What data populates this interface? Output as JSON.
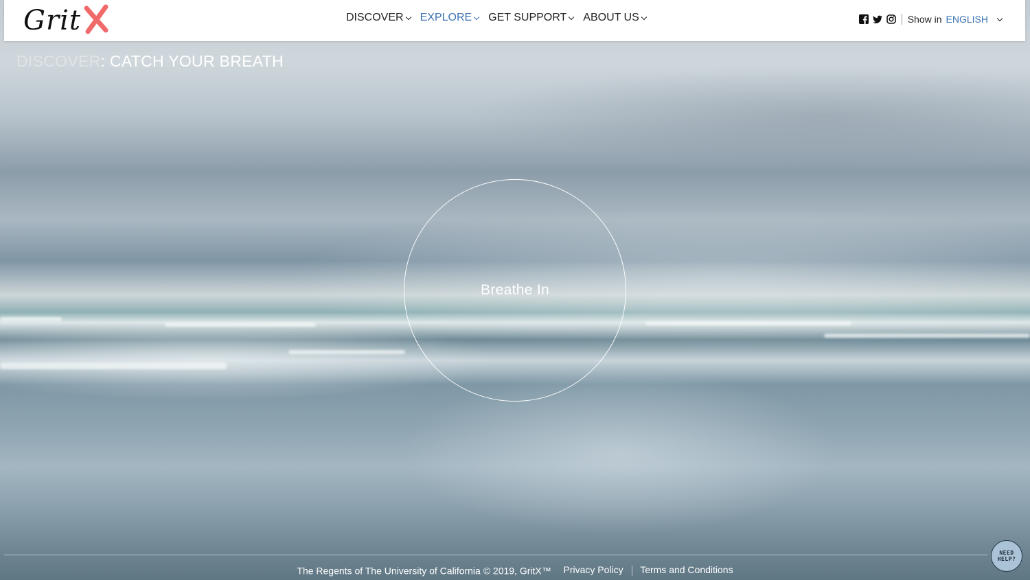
{
  "logo": {
    "text": "Grit",
    "accent": "X",
    "accent_color": "#f06a6a"
  },
  "nav": {
    "items": [
      {
        "label": "DISCOVER",
        "active": false
      },
      {
        "label": "EXPLORE",
        "active": true
      },
      {
        "label": "GET SUPPORT",
        "active": false
      },
      {
        "label": "ABOUT US",
        "active": false
      }
    ],
    "active_color": "#3a73b3"
  },
  "social": [
    "facebook-icon",
    "twitter-icon",
    "instagram-icon"
  ],
  "language": {
    "prefix": "Show in",
    "value": "ENGLISH"
  },
  "page": {
    "crumb": "DISCOVER",
    "title": ": CATCH YOUR BREATH"
  },
  "breathing": {
    "instruction": "Breathe In"
  },
  "footer": {
    "copyright": "The Regents of The University of California © 2019, GritX™",
    "privacy": "Privacy Policy",
    "terms": "Terms and Conditions"
  },
  "help": {
    "line1": "NEED",
    "line2": "HELP?"
  }
}
